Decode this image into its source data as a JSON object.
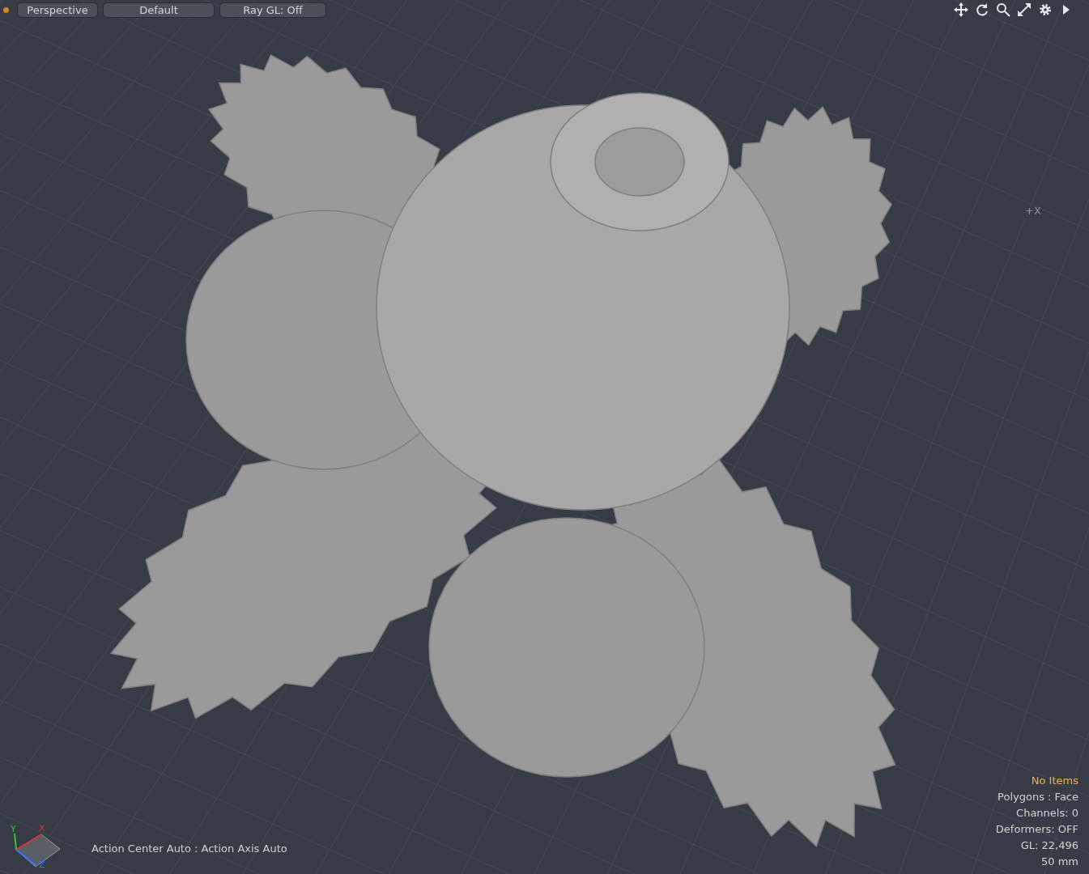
{
  "toolbar": {
    "indicator_on": true,
    "buttons": [
      {
        "label": "Perspective"
      },
      {
        "label": "Default"
      },
      {
        "label": "Ray GL: Off"
      }
    ],
    "tools": [
      {
        "kind": "move"
      },
      {
        "kind": "rotate"
      },
      {
        "kind": "zoom"
      },
      {
        "kind": "maximize"
      },
      {
        "kind": "settings"
      },
      {
        "kind": "more"
      }
    ]
  },
  "viewport": {
    "axis_hint": "+X",
    "gizmo": {
      "x": "X",
      "y": "Y",
      "z": "Z"
    },
    "action_status": "Action Center Auto : Action Axis Auto",
    "info": [
      {
        "text": "No Items",
        "color": "#f0b43c"
      },
      {
        "text": "Polygons : Face",
        "color": "#d2d2d2"
      },
      {
        "text": "Channels: 0",
        "color": "#d2d2d2"
      },
      {
        "text": "Deformers: OFF",
        "color": "#d2d2d2"
      },
      {
        "text": "GL: 22,496",
        "color": "#d2d2d2"
      },
      {
        "text": "50 mm",
        "color": "#d2d2d2"
      }
    ]
  }
}
